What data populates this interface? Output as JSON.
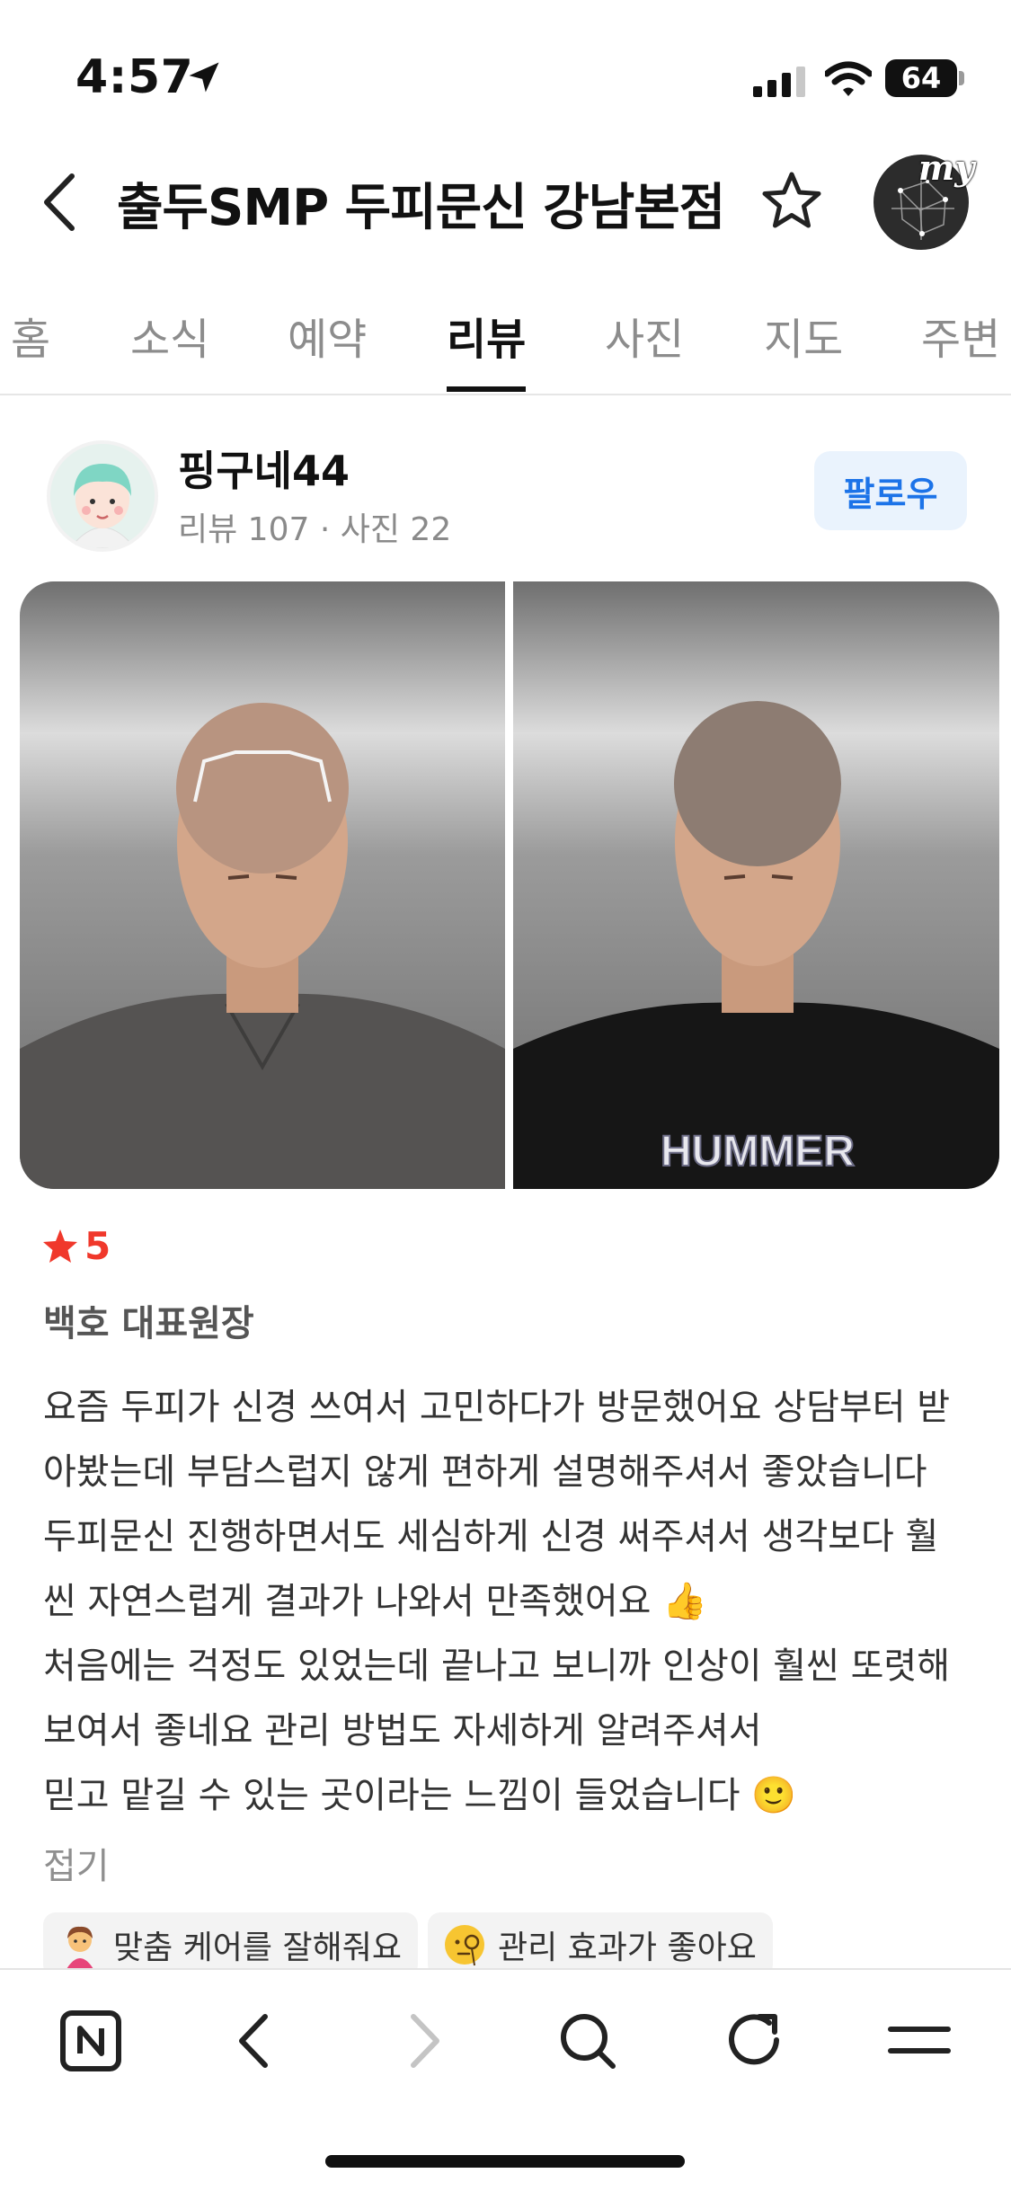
{
  "status_bar": {
    "time": "4:57",
    "battery": "64"
  },
  "header": {
    "title": "출두SMP 두피문신 강남본점",
    "my_label": "my"
  },
  "tabs": [
    {
      "label": "홈",
      "active": false
    },
    {
      "label": "소식",
      "active": false
    },
    {
      "label": "예약",
      "active": false
    },
    {
      "label": "리뷰",
      "active": true
    },
    {
      "label": "사진",
      "active": false
    },
    {
      "label": "지도",
      "active": false
    },
    {
      "label": "주변",
      "active": false
    }
  ],
  "reviewer": {
    "name": "핑구네44",
    "stats": "리뷰 107 · 사진 22",
    "follow_label": "팔로우"
  },
  "photos": {
    "right_shirt_text": "HUMMER"
  },
  "review": {
    "rating": "5",
    "staff": "백호 대표원장",
    "lines": [
      "요즘 두피가 신경 쓰여서 고민하다가 방문했어요 상담부터 받",
      "아봤는데 부담스럽지 않게 편하게 설명해주셔서 좋았습니다",
      "두피문신 진행하면서도 세심하게 신경 써주셔서 생각보다 훨",
      "씬 자연스럽게 결과가 나와서 만족했어요 👍",
      "처음에는 걱정도 있었는데 끝나고 보니까 인상이 훨씬 또렷해",
      "보여서 좋네요 관리 방법도 자세하게 알려주셔서",
      "믿고 맡길 수 있는 곳이라는 느낌이 들었습니다 🙂"
    ],
    "collapse_label": "접기",
    "keywords": [
      "맞춤 케어를 잘해줘요",
      "관리 효과가 좋아요"
    ]
  },
  "colors": {
    "accent_blue": "#1c73e8",
    "rating_red": "#f0382b",
    "follow_bg": "#eaf3fd"
  }
}
